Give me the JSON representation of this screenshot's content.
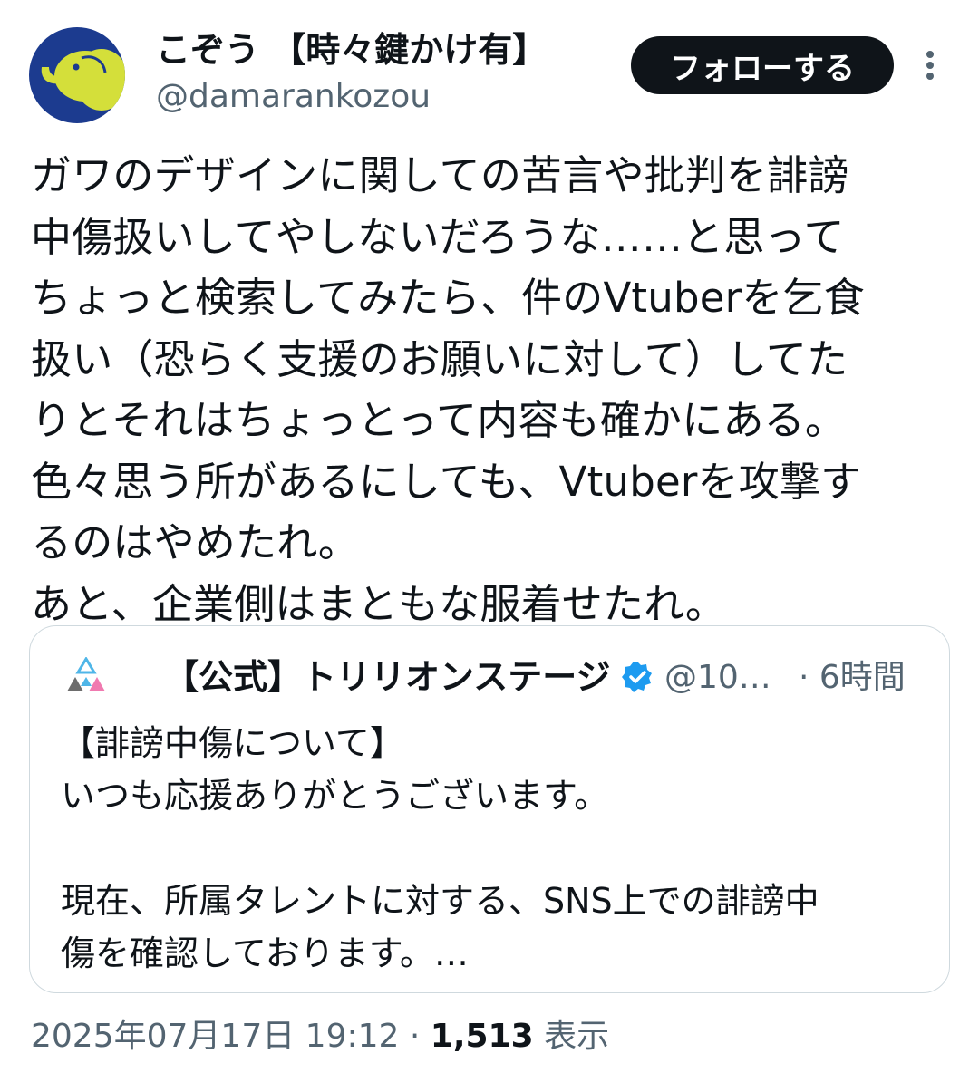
{
  "header": {
    "display_name": "こぞう 【時々鍵かけ有】",
    "handle": "@damarankozou",
    "follow_label": "フォローする",
    "avatar_icon": "elephant-icon"
  },
  "tweet": {
    "lines": [
      "ガワのデザインに関しての苦言や批判を誹謗",
      "中傷扱いしてやしないだろうな……と思って",
      "ちょっと検索してみたら、件のVtuberを乞食",
      "扱い（恐らく支援のお願いに対して）してた",
      "りとそれはちょっとって内容も確かにある。",
      "色々思う所があるにしても、Vtuberを攻撃す",
      "るのはやめたれ。",
      "あと、企業側はまともな服着せたれ。"
    ]
  },
  "quote": {
    "name": "【公式】トリリオンステージ",
    "handle": "@10…",
    "time": "· 6時間",
    "lines": [
      "【誹謗中傷について】",
      "いつも応援ありがとうございます。",
      "",
      "現在、所属タレントに対する、SNS上での誹謗中",
      "傷を確認しております。…"
    ]
  },
  "footer": {
    "timestamp": "2025年07月17日 19:12 · ",
    "views": "1,513",
    "views_label": " 表示"
  },
  "colors": {
    "text": "#0f1419",
    "muted": "#536471",
    "border": "#cfd9de",
    "verified": "#1d9bf0",
    "avatar_bg": "#1c3b8f",
    "elephant": "#d4df3a"
  }
}
